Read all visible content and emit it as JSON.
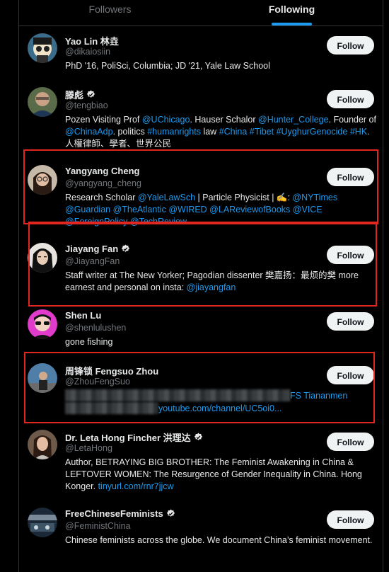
{
  "tabs": {
    "followers": "Followers",
    "following": "Following"
  },
  "users": [
    {
      "name": "Yao Lin 林垚",
      "handle": "@dikaiosiin",
      "bio": [
        {
          "t": "PhD '16, PoliSci, Columbia; JD '21, Yale Law School"
        }
      ],
      "button": "Follow"
    },
    {
      "name": "滕彪",
      "verified": true,
      "handle": "@tengbiao",
      "bio": [
        {
          "t": "Pozen Visiting Prof "
        },
        {
          "t": "@UChicago",
          "link": true
        },
        {
          "t": ". Hauser Schalor "
        },
        {
          "t": "@Hunter_College",
          "link": true
        },
        {
          "t": ". Founder of "
        },
        {
          "t": "@ChinaAdp",
          "link": true
        },
        {
          "t": ". politics "
        },
        {
          "t": "#humanrights",
          "link": true
        },
        {
          "t": " law "
        },
        {
          "t": "#China",
          "link": true
        },
        {
          "t": " "
        },
        {
          "t": "#Tibet",
          "link": true
        },
        {
          "t": " "
        },
        {
          "t": "#UyghurGenocide",
          "link": true
        },
        {
          "t": " "
        },
        {
          "t": "#HK",
          "link": true
        },
        {
          "t": ". 人權律師、學者、世界公民"
        }
      ],
      "button": "Follow"
    },
    {
      "name": "Yangyang Cheng",
      "handle": "@yangyang_cheng",
      "bio": [
        {
          "t": "Research Scholar "
        },
        {
          "t": "@YaleLawSch",
          "link": true
        },
        {
          "t": " | Particle Physicist | ✍️: "
        },
        {
          "t": "@NYTimes",
          "link": true
        },
        {
          "t": " "
        },
        {
          "t": "@Guardian",
          "link": true
        },
        {
          "t": " "
        },
        {
          "t": "@TheAtlantic",
          "link": true
        },
        {
          "t": " "
        },
        {
          "t": "@WIRED",
          "link": true
        },
        {
          "t": " "
        },
        {
          "t": "@LAReviewofBooks",
          "link": true
        },
        {
          "t": " "
        },
        {
          "t": "@VICE",
          "link": true
        },
        {
          "t": " "
        },
        {
          "t": "@ForeignPolicy",
          "link": true
        },
        {
          "t": " "
        },
        {
          "t": "@TechReview",
          "link": true
        },
        {
          "t": " ..."
        }
      ],
      "button": "Follow"
    },
    {
      "name": "Jiayang Fan",
      "verified": true,
      "handle": "@JiayangFan",
      "bio": [
        {
          "t": "Staff writer at The New Yorker; Pagodian dissenter 樊嘉扬：最烦的樊 more earnest and personal on insta: "
        },
        {
          "t": "@jiayangfan",
          "link": true
        }
      ],
      "button": "Follow"
    },
    {
      "name": "Shen Lu",
      "handle": "@shenlulushen",
      "bio": [
        {
          "t": "gone fishing"
        }
      ],
      "button": "Follow"
    },
    {
      "name": "周锋锁 Fengsuo Zhou",
      "handle": "@ZhouFengSuo",
      "bio_line1_visible": "FS Tiananmen",
      "bio_line2_visible": "youtube.com/channel/UC5oi0...",
      "button": "Follow"
    },
    {
      "name": "Dr. Leta Hong Fincher 洪理达",
      "verified": true,
      "handle": "@LetaHong",
      "bio": [
        {
          "t": "Author, BETRAYING BIG BROTHER: The Feminist Awakening in China & LEFTOVER WOMEN: The Resurgence of Gender Inequality in China. Hong Konger. "
        },
        {
          "t": "tinyurl.com/rnr7jjcw",
          "link": true
        }
      ],
      "button": "Follow"
    },
    {
      "name": "FreeChineseFeminists",
      "verified": true,
      "handle": "@FeministChina",
      "bio": [
        {
          "t": "Chinese feminists across the globe. We document China’s feminist movement."
        }
      ],
      "button": "Follow"
    }
  ],
  "colors": {
    "accent": "#1d9bf0",
    "highlight": "#e0261f",
    "background": "#000000"
  }
}
